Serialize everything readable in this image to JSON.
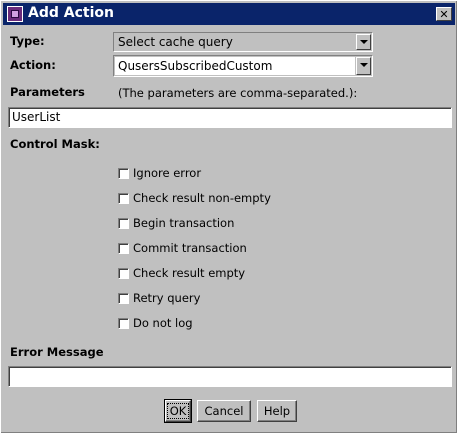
{
  "window": {
    "title": "Add Action"
  },
  "type_row": {
    "label": "Type:",
    "value": "Select cache query"
  },
  "action_row": {
    "label": "Action:",
    "value": "QusersSubscribedCustom"
  },
  "parameters": {
    "label": "Parameters",
    "hint": "(The parameters are comma-separated.):",
    "value": "UserList"
  },
  "control_mask": {
    "label": "Control Mask:",
    "options": [
      {
        "label": "Ignore error",
        "checked": false
      },
      {
        "label": "Check result non-empty",
        "checked": false
      },
      {
        "label": "Begin transaction",
        "checked": false
      },
      {
        "label": "Commit transaction",
        "checked": false
      },
      {
        "label": "Check result empty",
        "checked": false
      },
      {
        "label": "Retry query",
        "checked": false
      },
      {
        "label": "Do not log",
        "checked": false
      }
    ]
  },
  "error_message": {
    "label": "Error Message",
    "value": ""
  },
  "buttons": {
    "ok": "OK",
    "cancel": "Cancel",
    "help": "Help"
  },
  "colors": {
    "titlebar": "#0a246a",
    "face": "#c0c0c0"
  }
}
